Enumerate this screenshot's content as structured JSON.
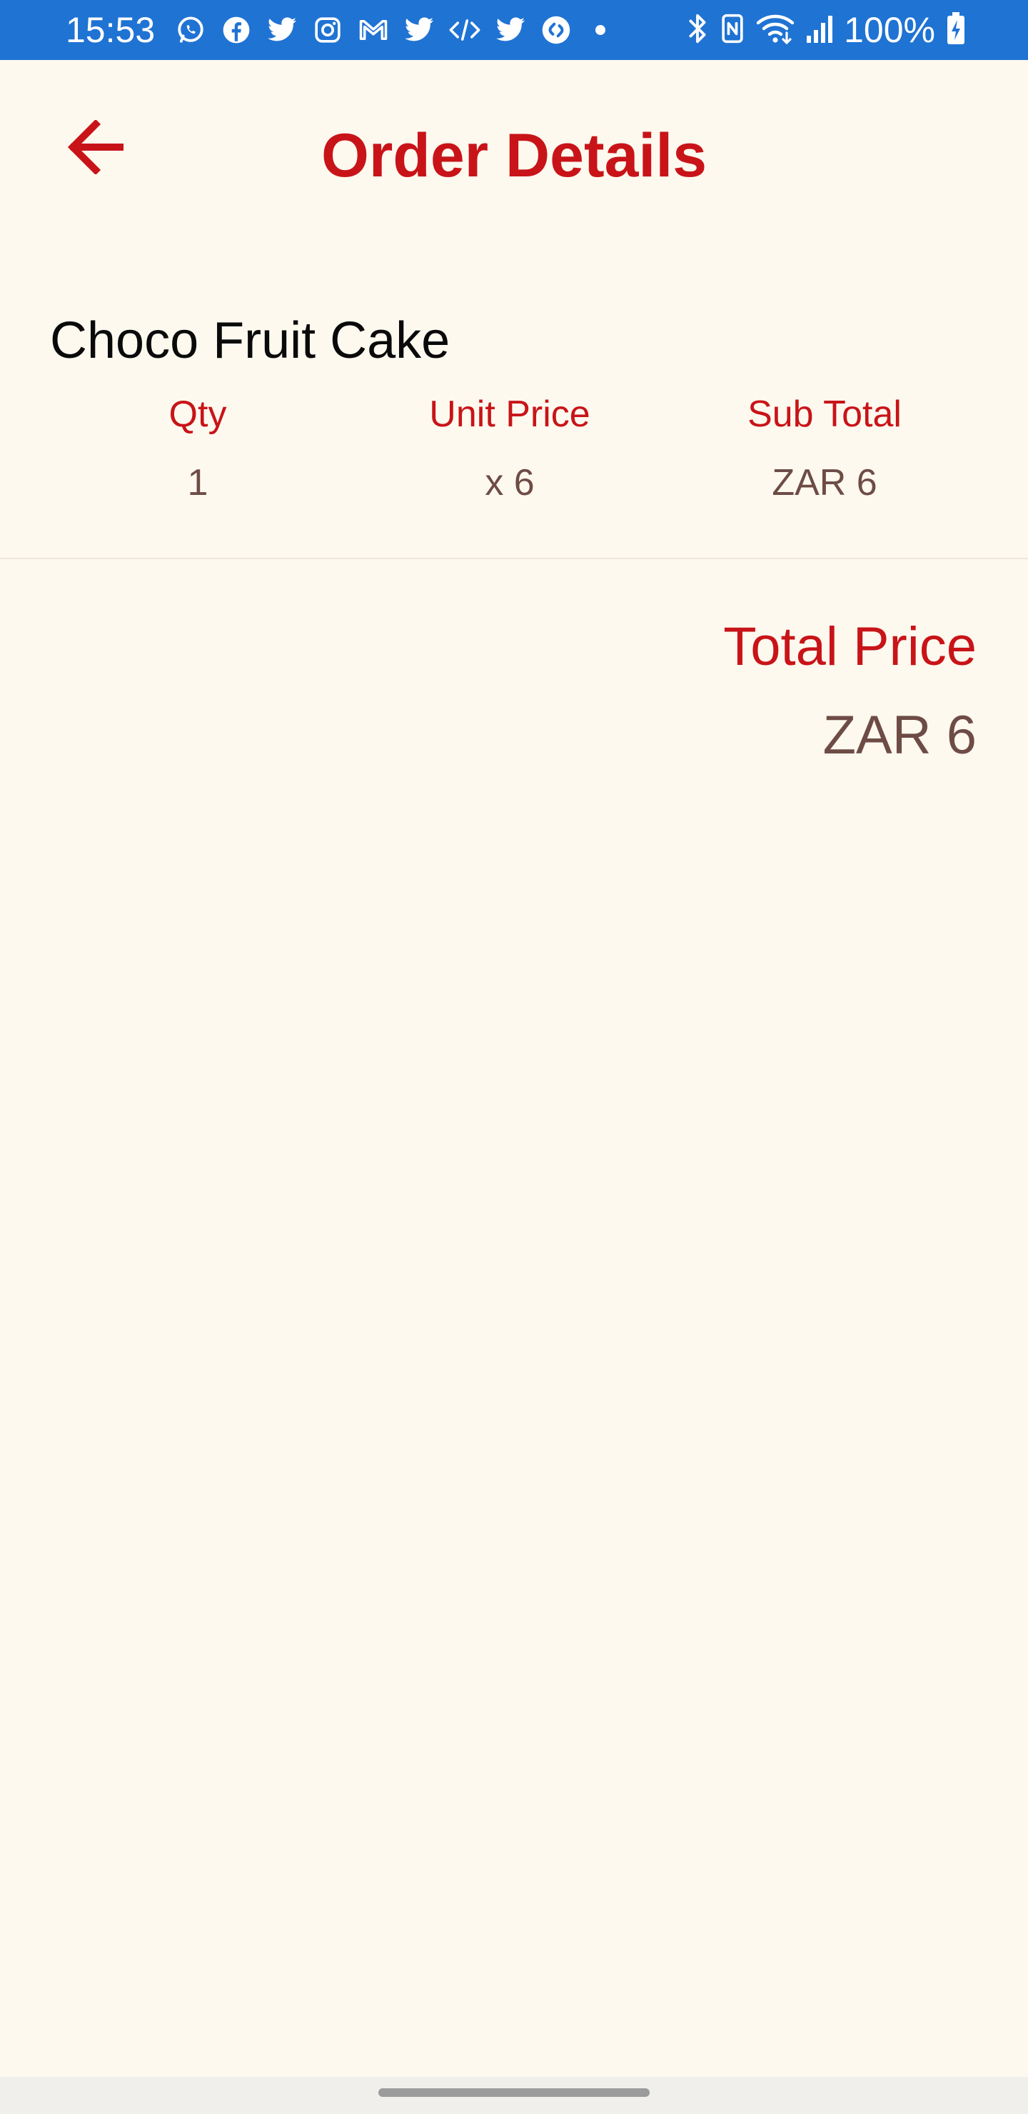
{
  "status_bar": {
    "time": "15:53",
    "battery": "100%",
    "notification_icons": [
      "whatsapp-icon",
      "facebook-icon",
      "twitter-icon",
      "instagram-icon",
      "gmail-icon",
      "twitter-icon",
      "code-icon",
      "twitter-icon",
      "shazam-icon"
    ],
    "system_icons": [
      "bluetooth-icon",
      "nfc-icon",
      "wifi-icon",
      "signal-icon",
      "battery-charging-icon"
    ]
  },
  "header": {
    "title": "Order Details",
    "back_icon": "arrow-back-icon"
  },
  "order": {
    "items": [
      {
        "name": "Choco Fruit Cake",
        "qty_label": "Qty",
        "qty": "1",
        "unit_price_label": "Unit Price",
        "unit_price": "x 6",
        "subtotal_label": "Sub Total",
        "subtotal": "ZAR 6"
      }
    ],
    "total_label": "Total Price",
    "total_value": "ZAR 6"
  },
  "colors": {
    "accent": "#c81418",
    "status_bar": "#1f73d3",
    "background": "#fdf9ef",
    "value_text": "#6e4c45"
  }
}
